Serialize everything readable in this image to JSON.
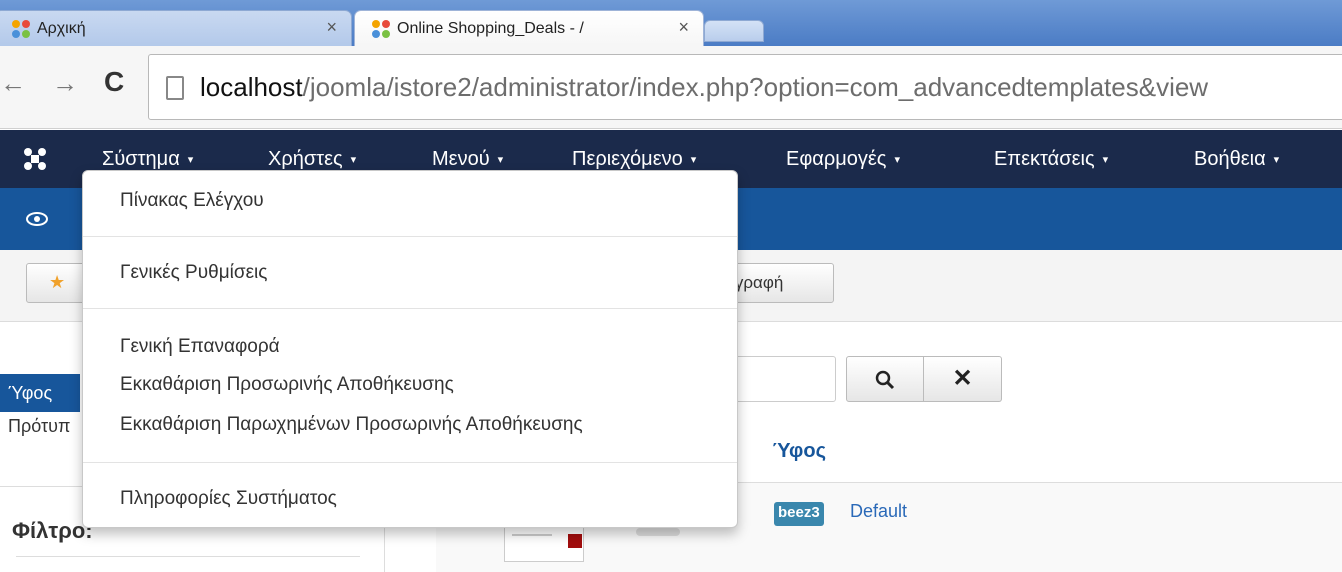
{
  "browser": {
    "tabs": [
      {
        "title": "Αρχική",
        "close": "×"
      },
      {
        "title": "Online Shopping_Deals - /",
        "close": "×"
      }
    ],
    "nav": {
      "back": "←",
      "forward": "→",
      "reload": "C"
    },
    "url": {
      "host": "localhost",
      "path": "/joomla/istore2/administrator/index.php?option=com_advancedtemplates&view"
    }
  },
  "admin_menu": {
    "items": [
      "Σύστημα",
      "Χρήστες",
      "Μενού",
      "Περιεχόμενο",
      "Εφαρμογές",
      "Επεκτάσεις",
      "Βοήθεια"
    ],
    "caret": "▾"
  },
  "dropdown": {
    "items": [
      "Πίνακας Ελέγχου",
      "Γενικές Ρυθμίσεις",
      "Γενική Επαναφορά",
      "Εκκαθάριση Προσωρινής Αποθήκευσης",
      "Εκκαθάριση Παρωχημένων Προσωρινής Αποθήκευσης",
      "Πληροφορίες Συστήματος"
    ]
  },
  "toolbar": {
    "save_partial": "αγραφή",
    "star": "★"
  },
  "sidebar": {
    "active": "Ύφος",
    "item": "Πρότυπ",
    "filter": "Φίλτρο:"
  },
  "search": {
    "search_icon": "🔍",
    "clear_icon": "✕"
  },
  "table": {
    "column_style": "Ύφος",
    "rows": [
      {
        "badge": "beez3",
        "name": "Default"
      }
    ]
  },
  "colors": {
    "nav_bg": "#1b2a4b",
    "subheader_bg": "#17569b",
    "badge_bg": "#3a87ad"
  }
}
